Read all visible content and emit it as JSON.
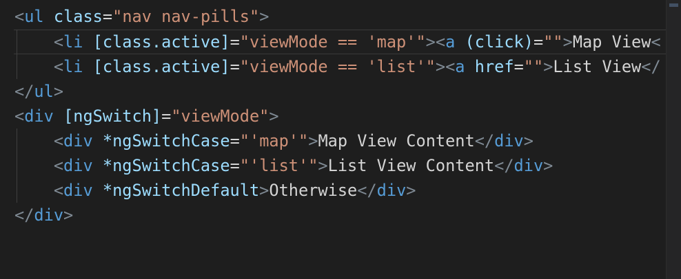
{
  "editor": {
    "lines": [
      [
        {
          "c": "t",
          "v": "<"
        },
        {
          "c": "tn",
          "v": "ul"
        },
        {
          "c": "tx",
          "v": " "
        },
        {
          "c": "an",
          "v": "class"
        },
        {
          "c": "eq",
          "v": "="
        },
        {
          "c": "sv",
          "v": "\"nav nav-pills\""
        },
        {
          "c": "t",
          "v": ">"
        }
      ],
      [
        {
          "c": "tx",
          "v": "    "
        },
        {
          "c": "t",
          "v": "<"
        },
        {
          "c": "tn",
          "v": "li"
        },
        {
          "c": "tx",
          "v": " "
        },
        {
          "c": "an",
          "v": "[class.active]"
        },
        {
          "c": "eq",
          "v": "="
        },
        {
          "c": "sv",
          "v": "\"viewMode == 'map'\""
        },
        {
          "c": "t",
          "v": "><"
        },
        {
          "c": "tn",
          "v": "a"
        },
        {
          "c": "tx",
          "v": " "
        },
        {
          "c": "an",
          "v": "(click)"
        },
        {
          "c": "eq",
          "v": "="
        },
        {
          "c": "sv",
          "v": "\"\""
        },
        {
          "c": "t",
          "v": ">"
        },
        {
          "c": "tx",
          "v": "Map View"
        },
        {
          "c": "t",
          "v": "<"
        }
      ],
      [
        {
          "c": "tx",
          "v": "    "
        },
        {
          "c": "t",
          "v": "<"
        },
        {
          "c": "tn",
          "v": "li"
        },
        {
          "c": "tx",
          "v": " "
        },
        {
          "c": "an",
          "v": "[class.active]"
        },
        {
          "c": "eq",
          "v": "="
        },
        {
          "c": "sv",
          "v": "\"viewMode == 'list'\""
        },
        {
          "c": "t",
          "v": "><"
        },
        {
          "c": "tn",
          "v": "a"
        },
        {
          "c": "tx",
          "v": " "
        },
        {
          "c": "an",
          "v": "href"
        },
        {
          "c": "eq",
          "v": "="
        },
        {
          "c": "sv",
          "v": "\"\""
        },
        {
          "c": "t",
          "v": ">"
        },
        {
          "c": "tx",
          "v": "List View"
        },
        {
          "c": "t",
          "v": "</"
        }
      ],
      [
        {
          "c": "t",
          "v": "</"
        },
        {
          "c": "tn",
          "v": "ul"
        },
        {
          "c": "t",
          "v": ">"
        }
      ],
      [
        {
          "c": "t",
          "v": "<"
        },
        {
          "c": "tn",
          "v": "div"
        },
        {
          "c": "tx",
          "v": " "
        },
        {
          "c": "an",
          "v": "[ngSwitch]"
        },
        {
          "c": "eq",
          "v": "="
        },
        {
          "c": "sv",
          "v": "\"viewMode\""
        },
        {
          "c": "t",
          "v": ">"
        }
      ],
      [
        {
          "c": "tx",
          "v": "    "
        },
        {
          "c": "t",
          "v": "<"
        },
        {
          "c": "tn",
          "v": "div"
        },
        {
          "c": "tx",
          "v": " "
        },
        {
          "c": "an",
          "v": "*ngSwitchCase"
        },
        {
          "c": "eq",
          "v": "="
        },
        {
          "c": "sv",
          "v": "\"'map'\""
        },
        {
          "c": "t",
          "v": ">"
        },
        {
          "c": "tx",
          "v": "Map View Content"
        },
        {
          "c": "t",
          "v": "</"
        },
        {
          "c": "tn",
          "v": "div"
        },
        {
          "c": "t",
          "v": ">"
        }
      ],
      [
        {
          "c": "tx",
          "v": "    "
        },
        {
          "c": "t",
          "v": "<"
        },
        {
          "c": "tn",
          "v": "div"
        },
        {
          "c": "tx",
          "v": " "
        },
        {
          "c": "an",
          "v": "*ngSwitchCase"
        },
        {
          "c": "eq",
          "v": "="
        },
        {
          "c": "sv",
          "v": "\"'list'\""
        },
        {
          "c": "t",
          "v": ">"
        },
        {
          "c": "tx",
          "v": "List View Content"
        },
        {
          "c": "t",
          "v": "</"
        },
        {
          "c": "tn",
          "v": "div"
        },
        {
          "c": "t",
          "v": ">"
        }
      ],
      [
        {
          "c": "tx",
          "v": "    "
        },
        {
          "c": "t",
          "v": "<"
        },
        {
          "c": "tn",
          "v": "div"
        },
        {
          "c": "tx",
          "v": " "
        },
        {
          "c": "an",
          "v": "*ngSwitchDefault"
        },
        {
          "c": "t",
          "v": ">"
        },
        {
          "c": "tx",
          "v": "Otherwise"
        },
        {
          "c": "t",
          "v": "</"
        },
        {
          "c": "tn",
          "v": "div"
        },
        {
          "c": "t",
          "v": ">"
        }
      ],
      [
        {
          "c": "t",
          "v": "</"
        },
        {
          "c": "tn",
          "v": "div"
        },
        {
          "c": "t",
          "v": ">"
        }
      ]
    ]
  },
  "theme": {
    "background": "#1e1e1e",
    "tag_bracket": "#7f8a94",
    "tag_name": "#569cd6",
    "attribute_name": "#9cdcfe",
    "string_value": "#ce9178",
    "text": "#d4d4d4"
  }
}
